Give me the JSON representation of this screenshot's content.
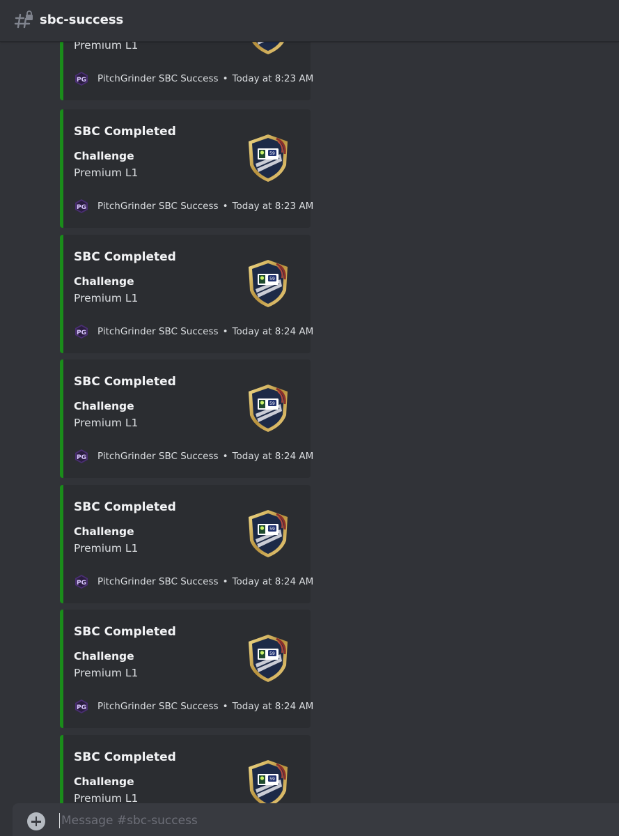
{
  "channel": {
    "name": "sbc-success",
    "icon": "hashtag-lock-icon"
  },
  "embeds": [
    {
      "title": "",
      "field_name": "",
      "field_value": "Premium L1",
      "author": "PitchGrinder SBC Success",
      "separator": "•",
      "timestamp": "Today at 8:23 AM"
    },
    {
      "title": "SBC Completed",
      "field_name": "Challenge",
      "field_value": "Premium L1",
      "author": "PitchGrinder SBC Success",
      "separator": "•",
      "timestamp": "Today at 8:23 AM"
    },
    {
      "title": "SBC Completed",
      "field_name": "Challenge",
      "field_value": "Premium L1",
      "author": "PitchGrinder SBC Success",
      "separator": "•",
      "timestamp": "Today at 8:24 AM"
    },
    {
      "title": "SBC Completed",
      "field_name": "Challenge",
      "field_value": "Premium L1",
      "author": "PitchGrinder SBC Success",
      "separator": "•",
      "timestamp": "Today at 8:24 AM"
    },
    {
      "title": "SBC Completed",
      "field_name": "Challenge",
      "field_value": "Premium L1",
      "author": "PitchGrinder SBC Success",
      "separator": "•",
      "timestamp": "Today at 8:24 AM"
    },
    {
      "title": "SBC Completed",
      "field_name": "Challenge",
      "field_value": "Premium L1",
      "author": "PitchGrinder SBC Success",
      "separator": "•",
      "timestamp": "Today at 8:24 AM"
    },
    {
      "title": "SBC Completed",
      "field_name": "Challenge",
      "field_value": "Premium L1",
      "author": "",
      "separator": "",
      "timestamp": ""
    }
  ],
  "composer": {
    "placeholder": "Message #sbc-success",
    "add_icon": "plus-circle-icon"
  },
  "colors": {
    "embed_accent": "#1a8c1a",
    "background": "#313338",
    "embed_background": "#2b2d31"
  }
}
